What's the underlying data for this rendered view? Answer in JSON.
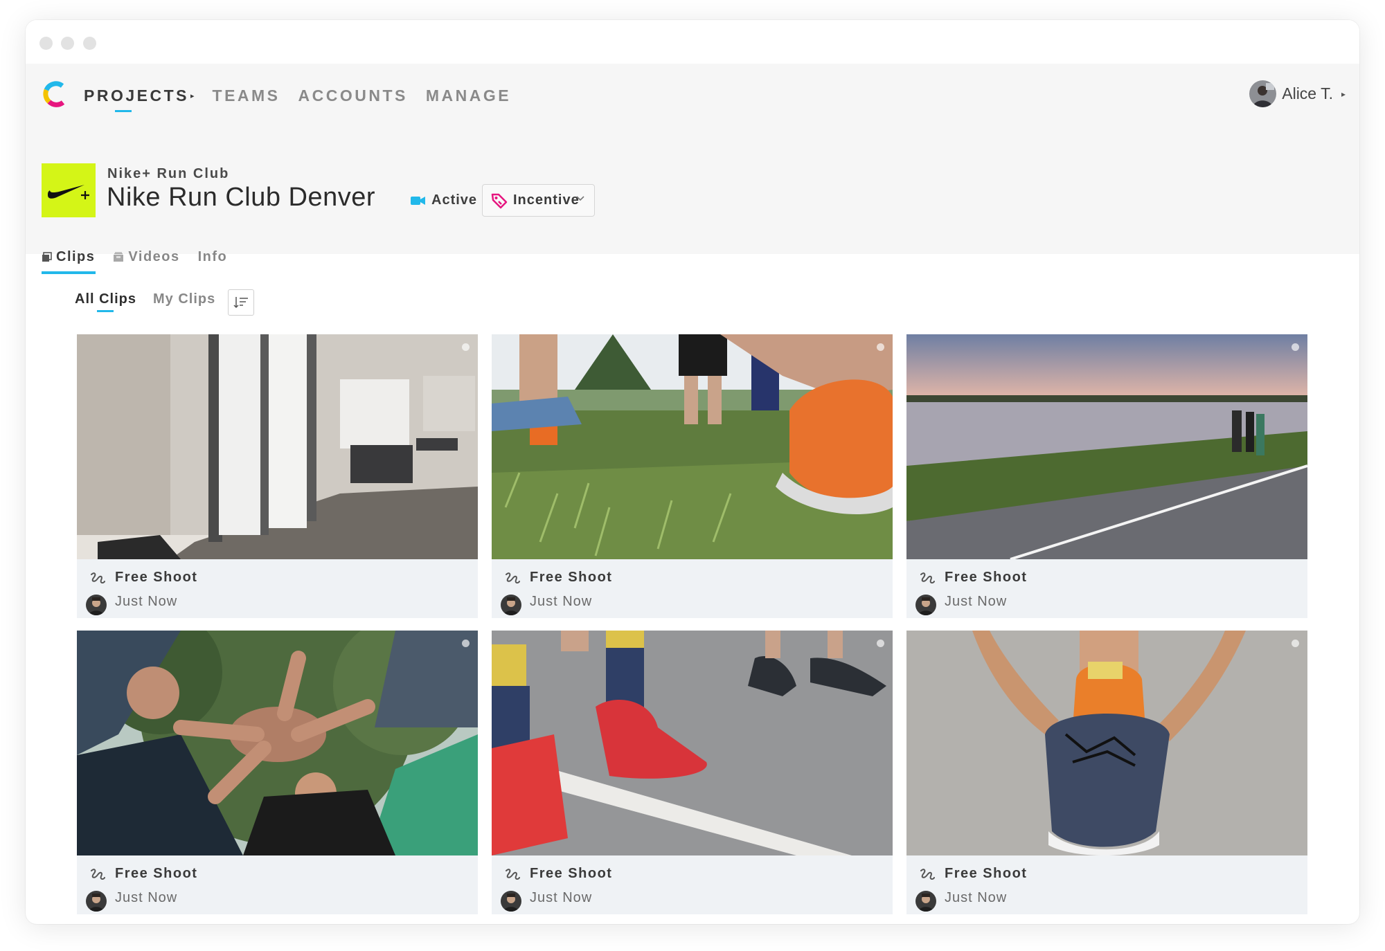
{
  "nav": {
    "items": [
      {
        "label": "PROJECTS",
        "active": true
      },
      {
        "label": "TEAMS",
        "active": false
      },
      {
        "label": "ACCOUNTS",
        "active": false
      },
      {
        "label": "MANAGE",
        "active": false
      }
    ],
    "user_name": "Alice T."
  },
  "project": {
    "org": "Nike+ Run Club",
    "title": "Nike Run Club Denver",
    "status": "Active",
    "tag": "Incentive"
  },
  "tabs": [
    {
      "label": "Clips",
      "icon": "clips-icon",
      "active": true
    },
    {
      "label": "Videos",
      "icon": "videos-icon",
      "active": false
    },
    {
      "label": "Info",
      "active": false
    }
  ],
  "filters": [
    {
      "label": "All Clips",
      "active": true
    },
    {
      "label": "My Clips",
      "active": false
    }
  ],
  "clips": [
    {
      "title": "Free Shoot",
      "meta": "Just Now",
      "scene": "office-doorway"
    },
    {
      "title": "Free Shoot",
      "meta": "Just Now",
      "scene": "grass-sneakers"
    },
    {
      "title": "Free Shoot",
      "meta": "Just Now",
      "scene": "lake-path"
    },
    {
      "title": "Free Shoot",
      "meta": "Just Now",
      "scene": "team-huddle"
    },
    {
      "title": "Free Shoot",
      "meta": "Just Now",
      "scene": "red-sneakers-road"
    },
    {
      "title": "Free Shoot",
      "meta": "Just Now",
      "scene": "tying-shoelace"
    }
  ],
  "colors": {
    "accent": "#21b8ea",
    "nike_green": "#d4f517",
    "tag_pink": "#e6167f",
    "card_bg": "#eff2f5"
  }
}
